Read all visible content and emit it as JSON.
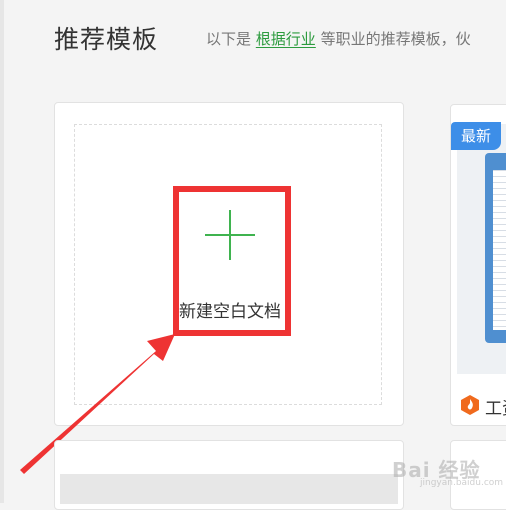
{
  "header": {
    "title": "推荐模板",
    "subtitle_prefix": "以下是",
    "subtitle_link": "根据行业",
    "subtitle_suffix": "等职业的推荐模板，伙"
  },
  "blank_card": {
    "label": "新建空白文档"
  },
  "template_card": {
    "badge": "最新",
    "name": "工资"
  },
  "watermark": {
    "text": "Bai 经验",
    "sub": "jingyan.baidu.com"
  },
  "colors": {
    "accent_green": "#3fb34f",
    "link_green": "#2c9b3e",
    "highlight_red": "#ee3333",
    "badge_blue": "#3d8ee8",
    "doc_icon_orange": "#f06a1d"
  },
  "icons": {
    "plus": "plus-icon",
    "template_type": "document-flame-icon"
  }
}
